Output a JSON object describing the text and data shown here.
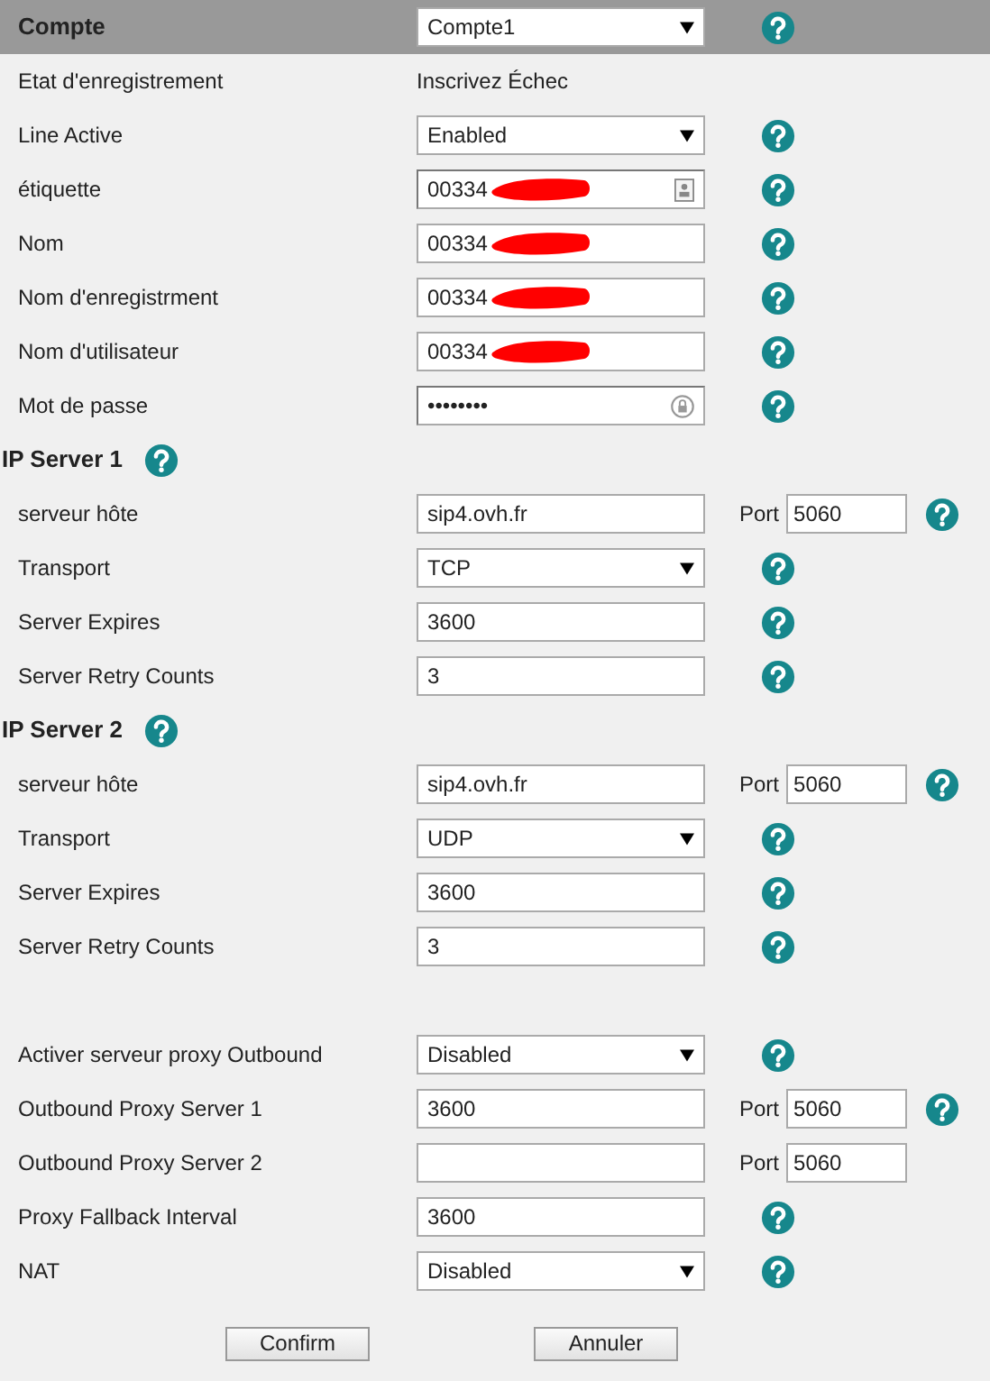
{
  "rows": [
    {
      "kind": "header",
      "label": "Compte",
      "value": "Compte1",
      "help": true
    },
    {
      "kind": "static",
      "label": "Etat d'enregistrement",
      "value": "Inscrivez Échec",
      "help": false
    },
    {
      "kind": "select",
      "label": "Line Active",
      "value": "Enabled",
      "help": true
    },
    {
      "kind": "input",
      "label": "étiquette",
      "value": "00334",
      "redacted": true,
      "card_icon": true,
      "help": true
    },
    {
      "kind": "input",
      "label": "Nom",
      "value": "00334",
      "redacted": true,
      "help": true
    },
    {
      "kind": "input",
      "label": "Nom d'enregistrment",
      "value": "00334",
      "redacted": true,
      "help": true
    },
    {
      "kind": "input",
      "label": "Nom d'utilisateur",
      "value": "00334",
      "redacted": true,
      "help": true
    },
    {
      "kind": "password",
      "label": "Mot de passe",
      "value": "••••••••",
      "help": true
    },
    {
      "kind": "section",
      "label": "IP Server 1",
      "help": true
    },
    {
      "kind": "input",
      "label": "serveur hôte",
      "value": "sip4.ovh.fr",
      "port_label": "Port",
      "port": "5060",
      "help": true
    },
    {
      "kind": "select",
      "label": "Transport",
      "value": "TCP",
      "help": true
    },
    {
      "kind": "input",
      "label": "Server Expires",
      "value": "3600",
      "help": true
    },
    {
      "kind": "input",
      "label": "Server Retry Counts",
      "value": "3",
      "help": true
    },
    {
      "kind": "section",
      "label": "IP Server 2",
      "help": true
    },
    {
      "kind": "input",
      "label": "serveur hôte",
      "value": "sip4.ovh.fr",
      "port_label": "Port",
      "port": "5060",
      "help": true
    },
    {
      "kind": "select",
      "label": "Transport",
      "value": "UDP",
      "help": true
    },
    {
      "kind": "input",
      "label": "Server Expires",
      "value": "3600",
      "help": true
    },
    {
      "kind": "input",
      "label": "Server Retry Counts",
      "value": "3",
      "help": true
    },
    {
      "kind": "spacer"
    },
    {
      "kind": "select",
      "label": "Activer serveur proxy Outbound",
      "value": "Disabled",
      "help": true
    },
    {
      "kind": "input",
      "label": "Outbound Proxy Server 1",
      "value": "3600",
      "port_label": "Port",
      "port": "5060",
      "help": true
    },
    {
      "kind": "input",
      "label": "Outbound Proxy Server 2",
      "port_label": "Port",
      "port": "5060",
      "help": false
    },
    {
      "kind": "input",
      "label": "Proxy Fallback Interval",
      "value": "3600",
      "help": true
    },
    {
      "kind": "select",
      "label": "NAT",
      "value": "Disabled",
      "help": true
    }
  ],
  "buttons": [
    "Confirm",
    "Annuler"
  ]
}
